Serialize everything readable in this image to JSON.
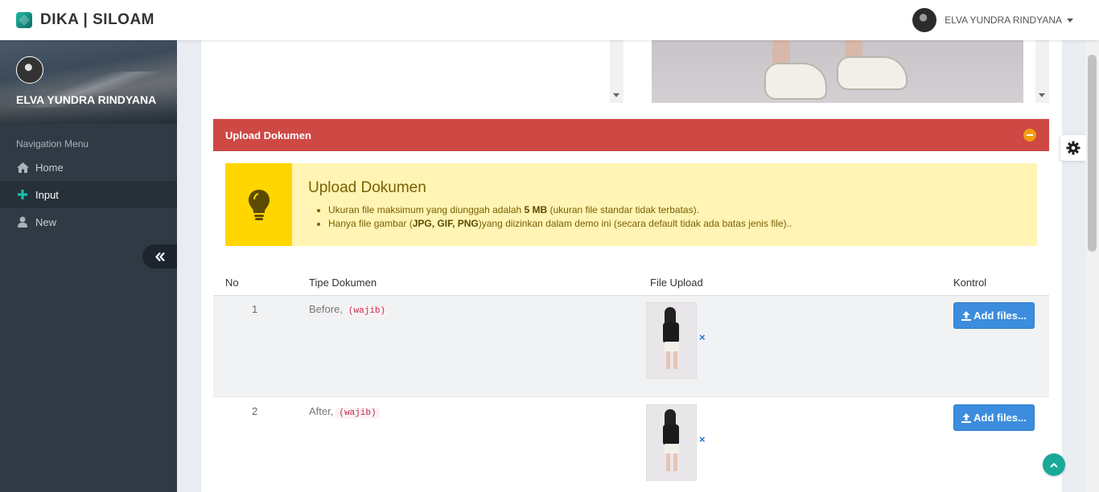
{
  "brand": {
    "name": "DIKA | SILOAM"
  },
  "user": {
    "name": "ELVA YUNDRA RINDYANA"
  },
  "sidebar": {
    "profile_name": "ELVA YUNDRA RINDYANA",
    "nav_title": "Navigation Menu",
    "items": [
      {
        "label": "Home",
        "icon": "home-icon"
      },
      {
        "label": "Input",
        "icon": "plus-icon",
        "active": true
      },
      {
        "label": "New",
        "icon": "user-icon"
      }
    ]
  },
  "panel": {
    "title": "Upload Dokumen",
    "accent": "#ce4844"
  },
  "callout": {
    "title": "Upload Dokumen",
    "line1_pre": "Ukuran file maksimum yang diunggah adalah ",
    "line1_bold": "5 MB",
    "line1_post": " (ukuran file standar tidak terbatas).",
    "line2_pre": "Hanya file gambar (",
    "line2_bold": "JPG, GIF, PNG",
    "line2_post": ")yang diizinkan dalam demo ini (secara default tidak ada batas jenis file).."
  },
  "table": {
    "headers": {
      "no": "No",
      "type": "Tipe Dokumen",
      "file": "File Upload",
      "control": "Kontrol"
    },
    "rows": [
      {
        "no": "1",
        "type": "Before,",
        "badge": "(wajib)",
        "remove": "×",
        "button": "Add files..."
      },
      {
        "no": "2",
        "type": "After,",
        "badge": "(wajib)",
        "remove": "×",
        "button": "Add files..."
      }
    ]
  },
  "colors": {
    "brand": "#138a7e",
    "primary_button": "#3c8dde",
    "callout_bg": "#fff4b3",
    "callout_icon_bg": "#ffd600",
    "sidebar_bg": "#2f3a45"
  }
}
